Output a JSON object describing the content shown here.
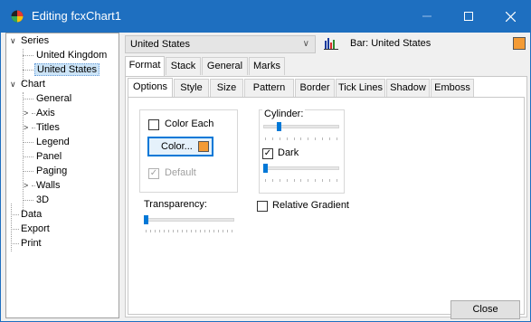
{
  "window": {
    "title": "Editing fcxChart1"
  },
  "tree": {
    "nodes": [
      {
        "label": "Series",
        "expanded": true
      },
      {
        "label": "United Kingdom"
      },
      {
        "label": "United States",
        "selected": true
      },
      {
        "label": "Chart",
        "expanded": true
      },
      {
        "label": "General"
      },
      {
        "label": "Axis",
        "expanded": false
      },
      {
        "label": "Titles",
        "expanded": false
      },
      {
        "label": "Legend"
      },
      {
        "label": "Panel"
      },
      {
        "label": "Paging"
      },
      {
        "label": "Walls",
        "expanded": false
      },
      {
        "label": "3D"
      },
      {
        "label": "Data"
      },
      {
        "label": "Export"
      },
      {
        "label": "Print"
      }
    ]
  },
  "series_selector": {
    "value": "United States",
    "title": "Bar: United States",
    "color": "#f49b35"
  },
  "tabs_main": [
    "Format",
    "Stack",
    "General",
    "Marks"
  ],
  "tabs_sub": [
    "Options",
    "Style",
    "Size",
    "Pattern",
    "Border",
    "Tick Lines",
    "Shadow",
    "Emboss"
  ],
  "options": {
    "color_each_label": "Color Each",
    "color_each_checked": false,
    "color_button_label": "Color...",
    "color_swatch": "#f49b35",
    "default_label": "Default",
    "default_checked": true,
    "cylinder_label": "Cylinder:",
    "cylinder_value": 0.2,
    "dark_label": "Dark",
    "dark_checked": true,
    "dark_value": 0.0,
    "transparency_label": "Transparency:",
    "transparency_value": 0.0,
    "relative_gradient_label": "Relative Gradient",
    "relative_gradient_checked": false
  },
  "footer": {
    "close_label": "Close"
  },
  "colors": {
    "titlebar": "#1e6fc0",
    "accent": "#0078d7",
    "selection": "#cce4f7"
  }
}
